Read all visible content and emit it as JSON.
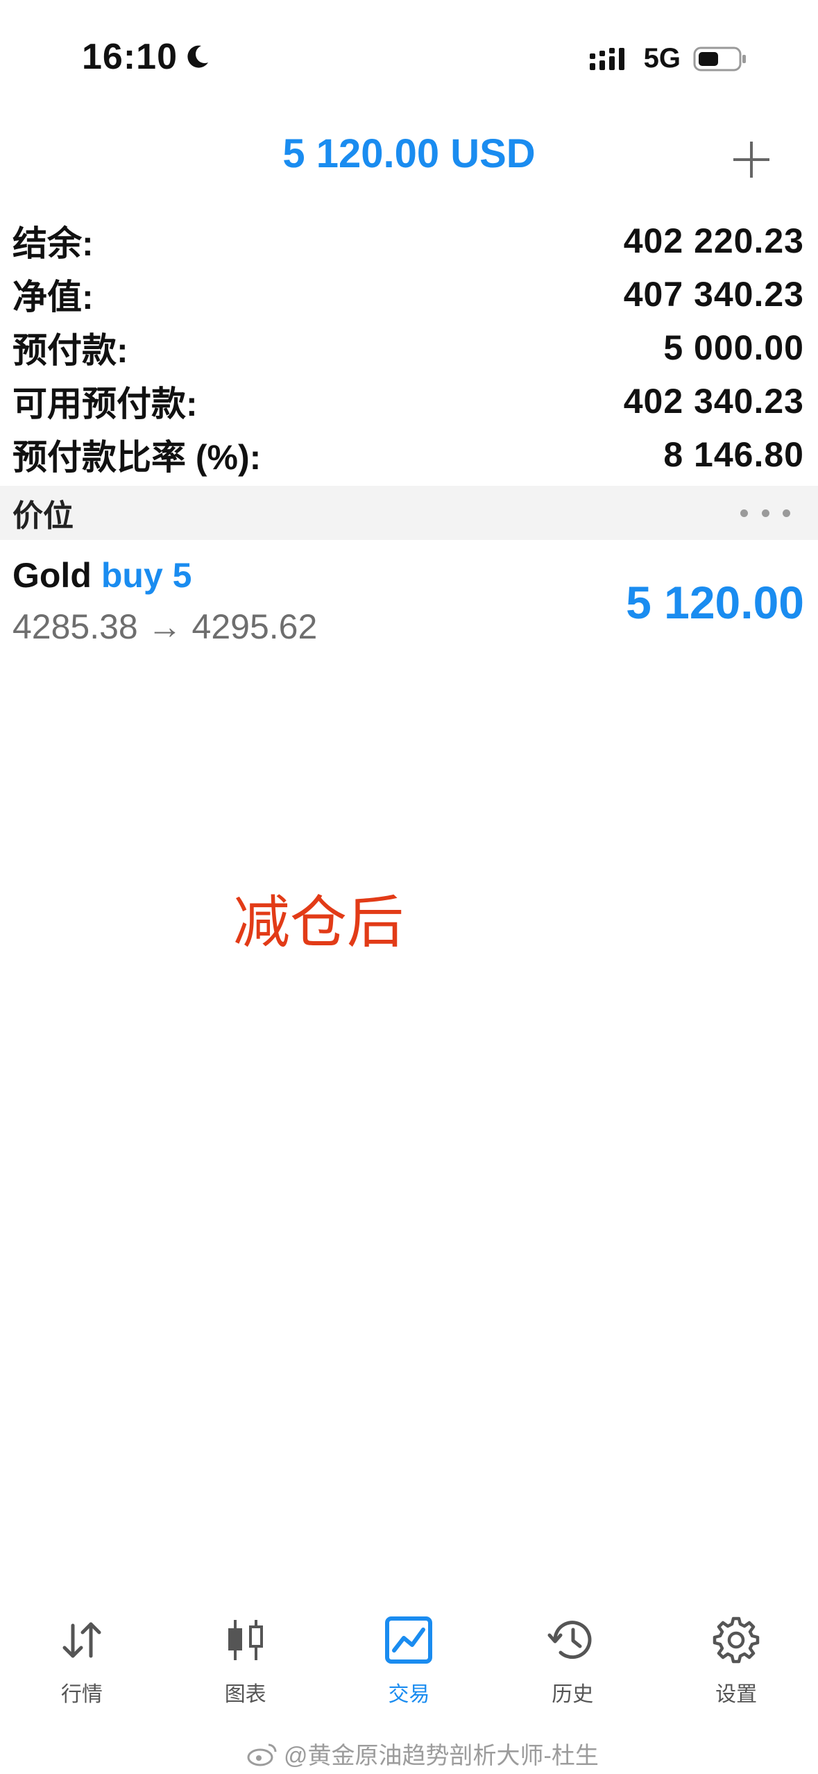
{
  "status_bar": {
    "time": "16:10",
    "network": "5G"
  },
  "header": {
    "title": "5 120.00 USD"
  },
  "summary": [
    {
      "label": "结余:",
      "value": "402 220.23"
    },
    {
      "label": "净值:",
      "value": "407 340.23"
    },
    {
      "label": "预付款:",
      "value": "5 000.00"
    },
    {
      "label": "可用预付款:",
      "value": "402 340.23"
    },
    {
      "label": "预付款比率 (%):",
      "value": "8 146.80"
    }
  ],
  "section": {
    "title": "价位"
  },
  "position": {
    "symbol": "Gold",
    "side": "buy 5",
    "prices": "4285.38 → 4295.62",
    "profit": "5 120.00"
  },
  "annotation": "减仓后",
  "tabs": [
    {
      "label": "行情",
      "icon": "quotes-arrows-icon"
    },
    {
      "label": "图表",
      "icon": "candlestick-chart-icon"
    },
    {
      "label": "交易",
      "icon": "trade-chart-icon"
    },
    {
      "label": "历史",
      "icon": "history-clock-icon"
    },
    {
      "label": "设置",
      "icon": "settings-gear-icon"
    }
  ],
  "active_tab": "交易",
  "watermark": "@黄金原油趋势剖析大师-杜生",
  "colors": {
    "accent": "#1a8cf0",
    "annotation": "#e23b17",
    "section_bg": "#f3f3f3",
    "muted_text": "#6e6e6e"
  }
}
